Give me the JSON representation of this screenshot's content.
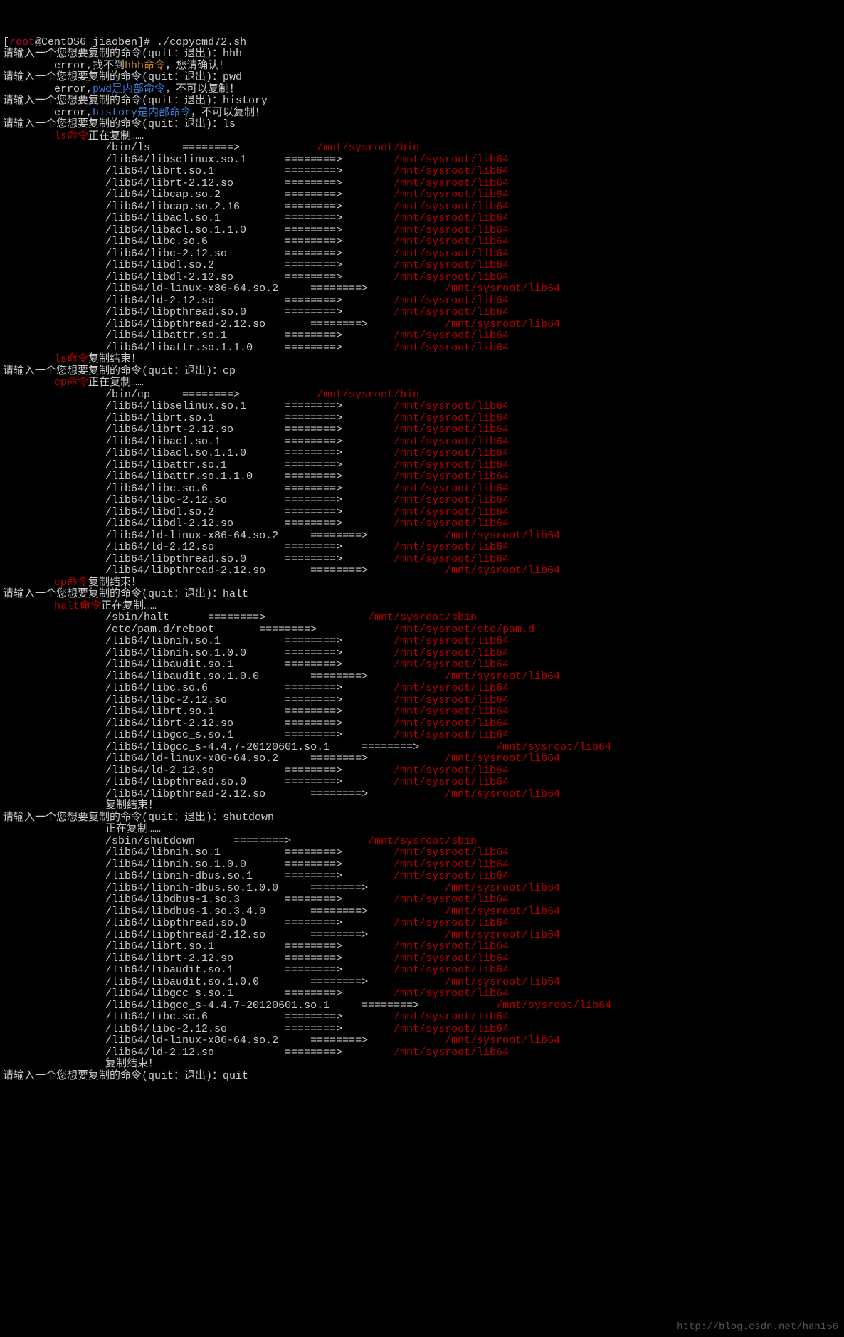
{
  "prompt": {
    "user": "root",
    "at": "@",
    "host": "CentOS6",
    "dir": "jiaoben",
    "hash": "#",
    "cmd1": "./copycmd72.sh"
  },
  "ask": "请输入一个您想要复制的命令(quit：退出)：",
  "inputs": {
    "hhh": "hhh",
    "pwd": "pwd",
    "history": "history",
    "ls": "ls",
    "cp": "cp",
    "halt": "halt",
    "shutdown": "shutdown",
    "quit": "quit"
  },
  "err_prefix": "        error,",
  "err_hhh_a": "找不到",
  "err_hhh_b": "hhh命令",
  "err_hhh_c": "，您请确认！",
  "err_pwd_b": "pwd是内部命令",
  "err_hist_b": "history是内部命令",
  "err_int_c": "，不可以复制！",
  "copying": "正在复制……",
  "copydone": "复制结束！",
  "cmdword": "命令",
  "indent8": "        ",
  "indent16": "                ",
  "arrow": "========>",
  "dest_bin": "/mnt/sysroot/bin",
  "dest_sbin": "/mnt/sysroot/sbin",
  "dest_lib": "/mnt/sysroot/lib64",
  "dest_pam": "/mnt/sysroot/etc/pam.d",
  "ls_bin": "/bin/ls",
  "cp_bin": "/bin/cp",
  "halt_bin": "/sbin/halt",
  "sd_bin": "/sbin/shutdown",
  "pam_reboot": "/etc/pam.d/reboot",
  "libs": {
    "selinux": "/lib64/libselinux.so.1",
    "rt1": "/lib64/librt.so.1",
    "rt212": "/lib64/librt-2.12.so",
    "cap2": "/lib64/libcap.so.2",
    "cap216": "/lib64/libcap.so.2.16",
    "acl1": "/lib64/libacl.so.1",
    "acl110": "/lib64/libacl.so.1.1.0",
    "c6": "/lib64/libc.so.6",
    "c212": "/lib64/libc-2.12.so",
    "dl2": "/lib64/libdl.so.2",
    "dl212": "/lib64/libdl-2.12.so",
    "ldlinux": "/lib64/ld-linux-x86-64.so.2",
    "ld212": "/lib64/ld-2.12.so",
    "pt0": "/lib64/libpthread.so.0",
    "pt212": "/lib64/libpthread-2.12.so",
    "attr1": "/lib64/libattr.so.1",
    "attr110": "/lib64/libattr.so.1.1.0",
    "nih1": "/lib64/libnih.so.1",
    "nih100": "/lib64/libnih.so.1.0.0",
    "audit1": "/lib64/libaudit.so.1",
    "audit100": "/lib64/libaudit.so.1.0.0",
    "gcc1": "/lib64/libgcc_s.so.1",
    "gcc447": "/lib64/libgcc_s-4.4.7-20120601.so.1",
    "nihdbus1": "/lib64/libnih-dbus.so.1",
    "nihdbus100": "/lib64/libnih-dbus.so.1.0.0",
    "dbus13": "/lib64/libdbus-1.so.3",
    "dbus1340": "/lib64/libdbus-1.so.3.4.0"
  },
  "watermark": "http://blog.csdn.net/han156"
}
